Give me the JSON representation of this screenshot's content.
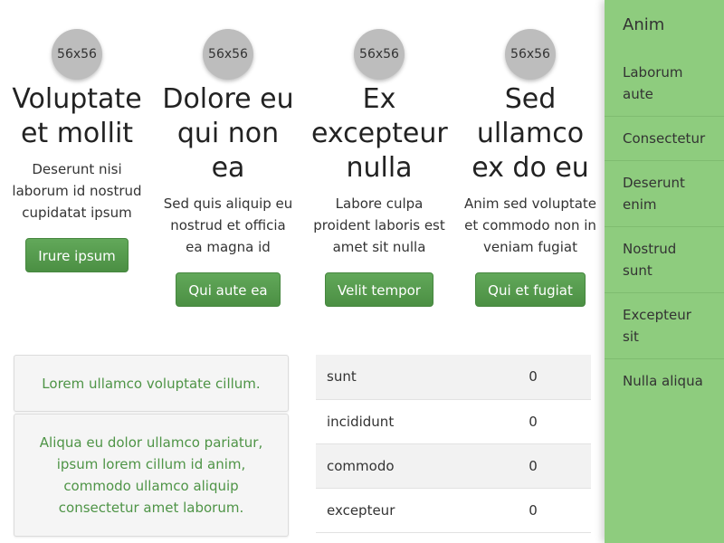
{
  "columns": [
    {
      "avatar": "56x56",
      "title": "Voluptate et mollit",
      "text": "Deserunt nisi laborum id nostrud cupidatat ipsum",
      "button": "Irure ipsum"
    },
    {
      "avatar": "56x56",
      "title": "Dolore eu qui non ea",
      "text": "Sed quis aliquip eu nostrud et officia ea magna id",
      "button": "Qui aute ea"
    },
    {
      "avatar": "56x56",
      "title": "Ex excepteur nulla",
      "text": "Labore culpa proident laboris est amet sit nulla",
      "button": "Velit tempor"
    },
    {
      "avatar": "56x56",
      "title": "Sed ullamco ex do eu",
      "text": "Anim sed voluptate et commodo non in veniam fugiat",
      "button": "Qui et fugiat"
    }
  ],
  "cards": [
    "Lorem ullamco voluptate cillum.",
    "Aliqua eu dolor ullamco pariatur, ipsum lorem cillum id anim, commodo ullamco aliquip consectetur amet laborum."
  ],
  "table": [
    {
      "name": "sunt",
      "value": "0"
    },
    {
      "name": "incididunt",
      "value": "0"
    },
    {
      "name": "commodo",
      "value": "0"
    },
    {
      "name": "excepteur",
      "value": "0"
    }
  ],
  "sidebar": {
    "brand": "Anim",
    "items": [
      {
        "label": "Laborum aute"
      },
      {
        "label": "Consectetur"
      },
      {
        "label": "Deserunt enim"
      },
      {
        "label": "Nostrud sunt"
      },
      {
        "label": "Excepteur sit"
      },
      {
        "label": "Nulla aliqua"
      }
    ]
  },
  "colors": {
    "sidebar_bg": "#8ecc7e",
    "button_bg": "#56995a",
    "card_text": "#4e9446",
    "avatar_bg": "#bdbdbd"
  }
}
